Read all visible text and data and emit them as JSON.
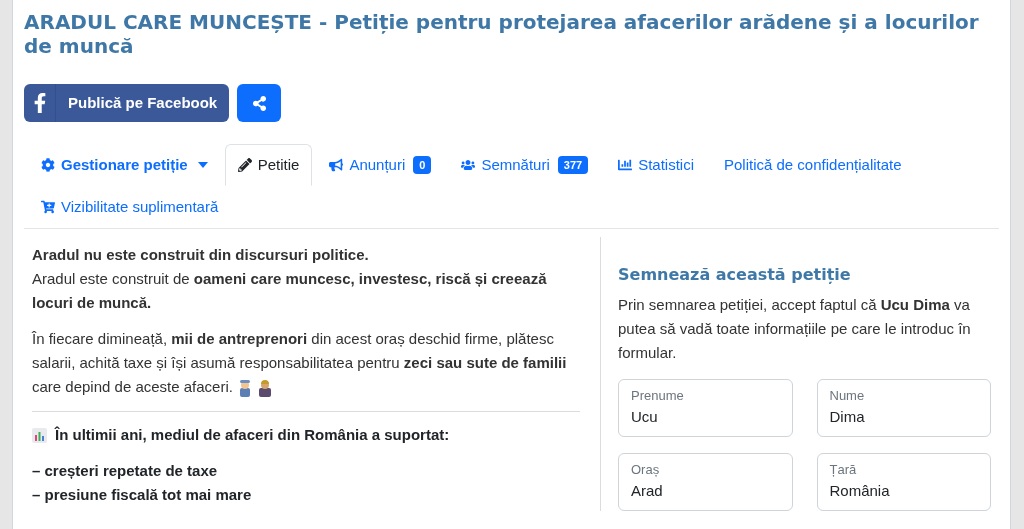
{
  "title": "ARADUL CARE MUNCEȘTE - Petiție pentru protejarea afacerilor arădene și a locurilor de muncă",
  "share": {
    "facebook_label": "Publică pe Facebook"
  },
  "tabs": [
    {
      "kind": "dropdown",
      "label": "Gestionare petiție",
      "selected": false
    },
    {
      "kind": "tab",
      "label": "Petitie",
      "selected": true
    },
    {
      "kind": "tab",
      "label": "Anunțuri",
      "badge": "0",
      "selected": false
    },
    {
      "kind": "tab",
      "label": "Semnături",
      "badge": "377",
      "selected": false
    },
    {
      "kind": "tab",
      "label": "Statistici",
      "selected": false
    },
    {
      "kind": "tab",
      "label": "Politică de confidențialitate",
      "selected": false
    },
    {
      "kind": "tab",
      "label": "Vizibilitate suplimentară",
      "selected": false
    }
  ],
  "body": [
    {
      "kind": "paragraph",
      "lines": [
        "**Aradul nu este construit din discursuri politice.**",
        "Aradul este construit de **oameni care muncesc, investesc, riscă și creează locuri de muncă.**"
      ]
    },
    {
      "kind": "paragraph",
      "lines": [
        "În fiecare dimineață, **mii de antreprenori** din acest oraș deschid firme, plătesc salarii, achită taxe și își asumă responsabilitatea pentru **zeci sau sute de familii** care depind de aceste afaceri."
      ]
    },
    {
      "kind": "rule"
    },
    {
      "kind": "heading",
      "text": "În ultimii ani, mediul de afaceri din România a suportat:"
    },
    {
      "kind": "list",
      "items": [
        "– creșteri repetate de taxe",
        "– presiune fiscală tot mai mare"
      ]
    }
  ],
  "sign": {
    "title": "Semnează această petiție",
    "consent": "Prin semnarea petiției, accept faptul că **Ucu Dima** va putea să vadă toate informațiile pe care le introduc în formular.",
    "fields": [
      {
        "label": "Prenume",
        "value": "Ucu"
      },
      {
        "label": "Nume",
        "value": "Dima"
      },
      {
        "label": "Oraș",
        "value": "Arad"
      },
      {
        "label": "Țară",
        "value": "România"
      }
    ]
  }
}
